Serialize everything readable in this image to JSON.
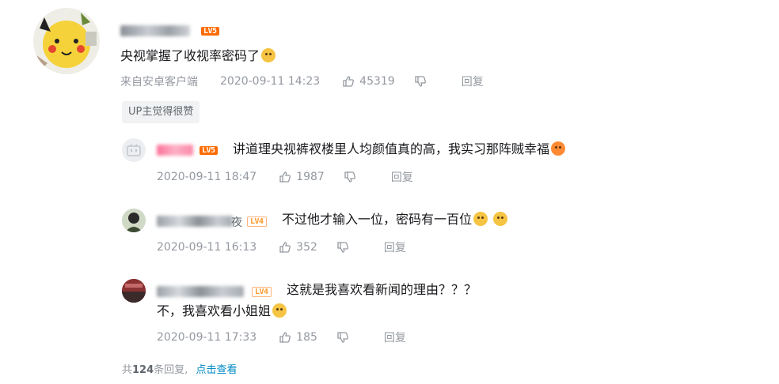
{
  "main_comment": {
    "level": "LV5",
    "text": "央视掌握了收视率密码了",
    "source": "来自安卓客户端",
    "date": "2020-09-11 14:23",
    "likes": "45319",
    "reply_label": "回复",
    "badge": "UP主觉得很赞"
  },
  "replies": [
    {
      "level": "LV5",
      "text": "讲道理央视裤衩楼里人均颜值真的高，我实习那阵贼幸福",
      "date": "2020-09-11 18:47",
      "likes": "1987",
      "reply_label": "回复"
    },
    {
      "level": "LV4",
      "name_tail": "夜",
      "text": "不过他才输入一位，密码有一百位",
      "date": "2020-09-11 16:13",
      "likes": "352",
      "reply_label": "回复"
    },
    {
      "level": "LV4",
      "text_line1": "这就是我喜欢看新闻的理由？？？",
      "text_line2": "不，我喜欢看小姐姐",
      "date": "2020-09-11 17:33",
      "likes": "185",
      "reply_label": "回复"
    }
  ],
  "footer": {
    "prefix": "共",
    "count": "124",
    "suffix": "条回复,",
    "view_link": "点击查看"
  },
  "colors": {
    "level_lv5": "#ff6c00",
    "level_lv4": "#ff9a2e",
    "meta_gray": "#9499a0",
    "link_blue": "#008ac5"
  },
  "icons": [
    "like-icon",
    "dislike-icon",
    "cat-emoji-icon",
    "blush-emoji-icon"
  ]
}
